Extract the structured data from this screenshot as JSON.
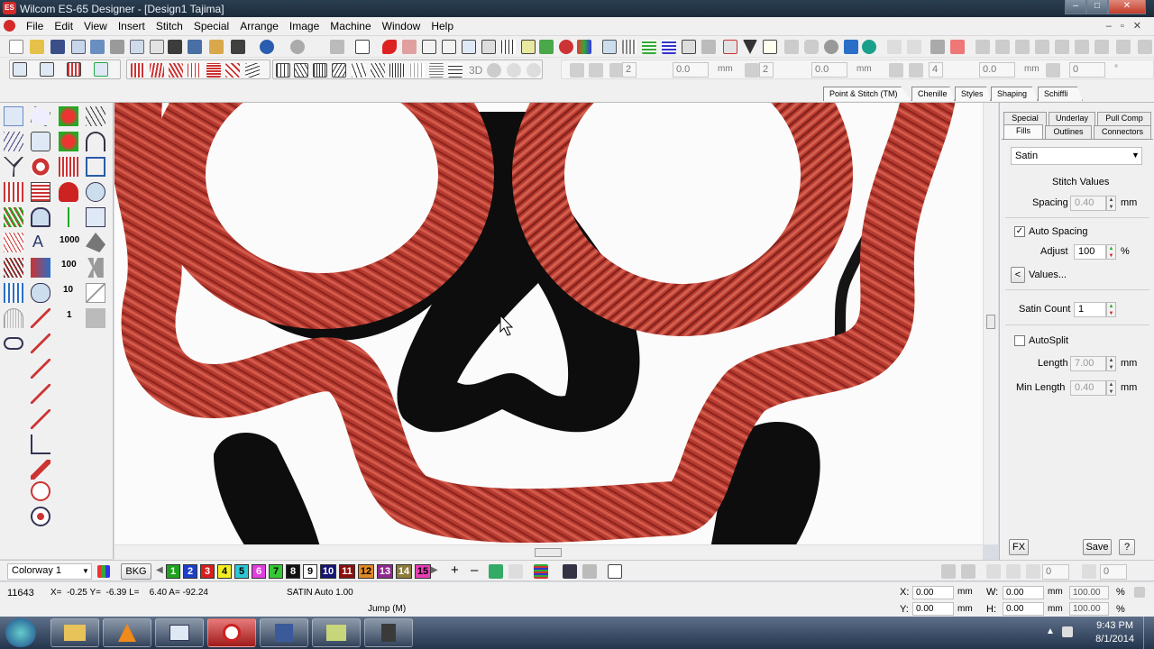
{
  "window": {
    "title": "Wilcom ES-65 Designer - [Design1       Tajima]",
    "app_icon": "ES",
    "controls": {
      "min": "–",
      "max": "□",
      "close": "✕"
    }
  },
  "menu": [
    "File",
    "Edit",
    "View",
    "Insert",
    "Stitch",
    "Special",
    "Arrange",
    "Image",
    "Machine",
    "Window",
    "Help"
  ],
  "toolbar2": {
    "fields": [
      {
        "value": "2",
        "unit": ""
      },
      {
        "value": "0.0",
        "unit": "mm"
      },
      {
        "value": "2",
        "unit": ""
      },
      {
        "value": "0.0",
        "unit": "mm"
      },
      {
        "value": "4",
        "unit": ""
      },
      {
        "value": "0.0",
        "unit": "mm"
      },
      {
        "value": "0",
        "unit": "°"
      }
    ],
    "label_3d": "3D"
  },
  "docker_tabs": [
    "Point & Stitch (TM)",
    "Chenille",
    "Styles",
    "Shaping",
    "Schiffli"
  ],
  "object_properties": {
    "tabs_row1": [
      "Special",
      "Underlay",
      "Pull Comp"
    ],
    "tabs_row2": [
      "Fills",
      "Outlines",
      "Connectors"
    ],
    "stitch_type": "Satin",
    "section_title": "Stitch Values",
    "spacing_label": "Spacing",
    "spacing_value": "0.40",
    "spacing_unit": "mm",
    "auto_spacing_label": "Auto Spacing",
    "auto_spacing_checked": "✓",
    "adjust_label": "Adjust",
    "adjust_value": "100",
    "adjust_unit": "%",
    "values_button": "Values...",
    "values_arrow": "<",
    "satin_count_label": "Satin Count",
    "satin_count_value": "1",
    "autosplit_label": "AutoSplit",
    "length_label": "Length",
    "length_value": "7.00",
    "length_unit": "mm",
    "min_length_label": "Min Length",
    "min_length_value": "0.40",
    "min_length_unit": "mm",
    "fx_button": "FX",
    "save_button": "Save",
    "help_button": "?"
  },
  "colorbar": {
    "colorway": "Colorway 1",
    "bkg": "BKG",
    "swatches": [
      {
        "n": "1",
        "bg": "#1fa31f",
        "fg": "#ffffff"
      },
      {
        "n": "2",
        "bg": "#1d3fc7",
        "fg": "#ffffff"
      },
      {
        "n": "3",
        "bg": "#d81e1e",
        "fg": "#ffffff"
      },
      {
        "n": "4",
        "bg": "#f2ee22",
        "fg": "#000000"
      },
      {
        "n": "5",
        "bg": "#2cc8d6",
        "fg": "#000000"
      },
      {
        "n": "6",
        "bg": "#e33ee0",
        "fg": "#ffffff"
      },
      {
        "n": "7",
        "bg": "#34c934",
        "fg": "#000000"
      },
      {
        "n": "8",
        "bg": "#111111",
        "fg": "#ffffff"
      },
      {
        "n": "9",
        "bg": "#ffffff",
        "fg": "#000000"
      },
      {
        "n": "10",
        "bg": "#151575",
        "fg": "#ffffff"
      },
      {
        "n": "11",
        "bg": "#8a1010",
        "fg": "#ffffff"
      },
      {
        "n": "12",
        "bg": "#e08a25",
        "fg": "#000000"
      },
      {
        "n": "13",
        "bg": "#8e2a8e",
        "fg": "#ffffff"
      },
      {
        "n": "14",
        "bg": "#8e7d3a",
        "fg": "#ffffff"
      },
      {
        "n": "15",
        "bg": "#e83fb5",
        "fg": "#000000"
      }
    ],
    "right_fields": [
      "0",
      "0"
    ]
  },
  "status": {
    "stitch_count": "11643",
    "coords": "X=  -0.25 Y=  -6.39 L=    6.40 A= -92.24",
    "stitch_info": "SATIN Auto  1.00",
    "jump": "Jump (M)",
    "x_label": "X:",
    "x_value": "0.00",
    "x_unit": "mm",
    "y_label": "Y:",
    "y_value": "0.00",
    "y_unit": "mm",
    "w_label": "W:",
    "w_value": "0.00",
    "w_unit": "mm",
    "h_label": "H:",
    "h_value": "0.00",
    "h_unit": "mm",
    "w_pct": "100.00",
    "h_pct": "100.00",
    "pct": "%"
  },
  "taskbar": {
    "time": "9:43 PM",
    "date": "8/1/2014"
  },
  "colors": {
    "satin_red": "#b8392e",
    "satin_dark": "#8a2520",
    "black_fill": "#0d0d0d"
  }
}
